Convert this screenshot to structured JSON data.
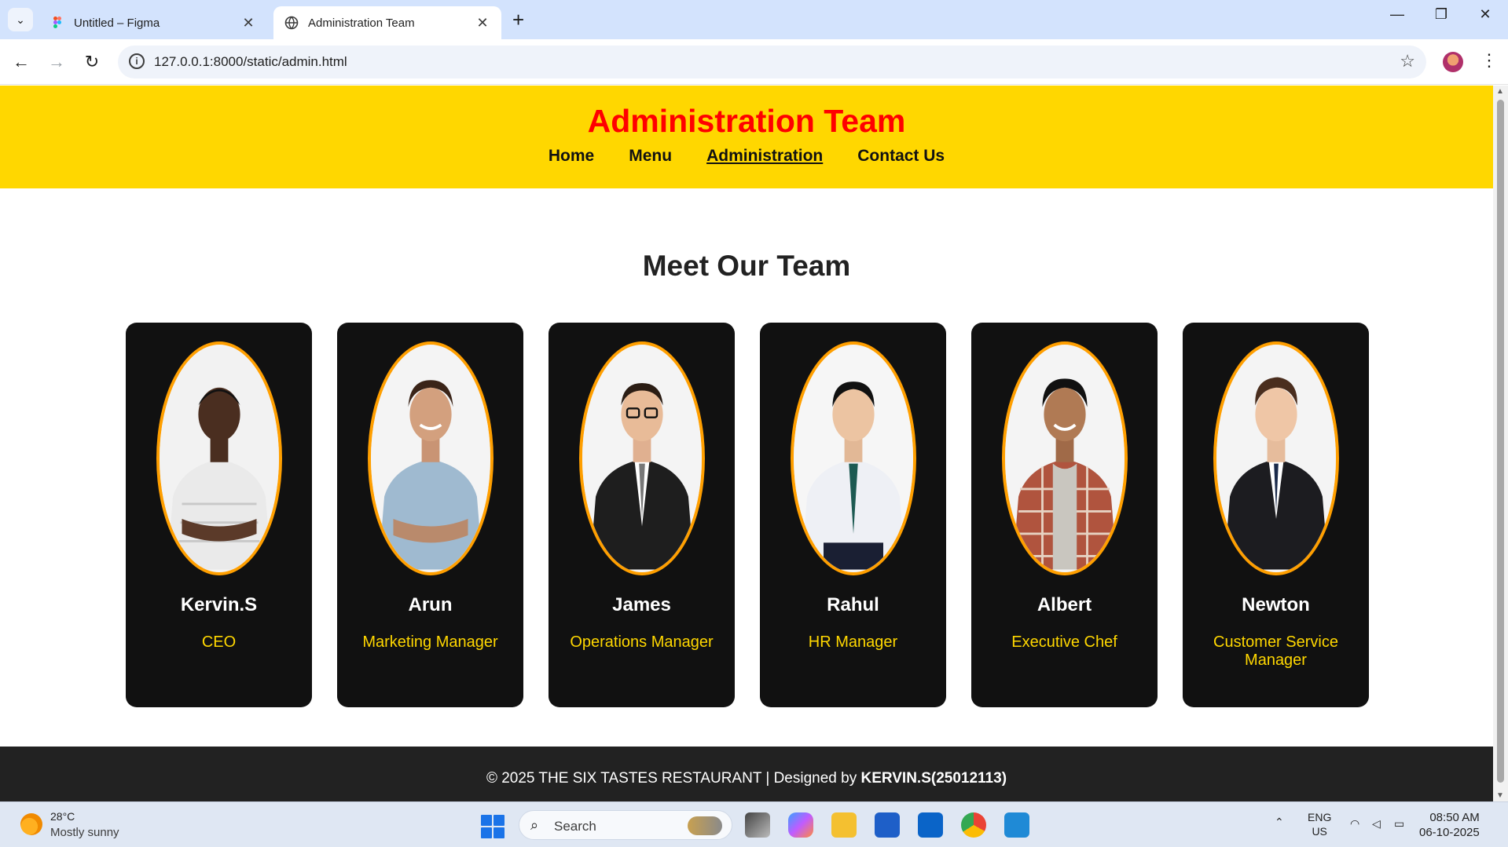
{
  "browser": {
    "tabs": [
      {
        "title": "Untitled – Figma",
        "active": false,
        "icon": "figma-icon"
      },
      {
        "title": "Administration Team",
        "active": true,
        "icon": "globe-icon"
      }
    ],
    "url": "127.0.0.1:8000/static/admin.html"
  },
  "site": {
    "title": "Administration Team",
    "nav": [
      {
        "label": "Home",
        "current": false
      },
      {
        "label": "Menu",
        "current": false
      },
      {
        "label": "Administration",
        "current": true
      },
      {
        "label": "Contact Us",
        "current": false
      }
    ],
    "section_title": "Meet Our Team",
    "team": [
      {
        "name": "Kervin.S",
        "role": "CEO",
        "outfit": "white-striped-shirt"
      },
      {
        "name": "Arun",
        "role": "Marketing Manager",
        "outfit": "blue-shirt"
      },
      {
        "name": "James",
        "role": "Operations Manager",
        "outfit": "black-suit"
      },
      {
        "name": "Rahul",
        "role": "HR Manager",
        "outfit": "white-shirt-tie"
      },
      {
        "name": "Albert",
        "role": "Executive Chef",
        "outfit": "plaid-shirt"
      },
      {
        "name": "Newton",
        "role": "Customer Service Manager",
        "outfit": "black-suit"
      }
    ],
    "footer": {
      "text": "© 2025 THE SIX TASTES RESTAURANT | Designed by ",
      "designer": "KERVIN.S(25012113)"
    },
    "colors": {
      "header_bg": "#ffd700",
      "title": "#ff0000",
      "card_bg": "#111111",
      "photo_border": "#ff9f00",
      "role_text": "#ffd700",
      "footer_bg": "#222222"
    }
  },
  "taskbar": {
    "weather": {
      "temp": "28°C",
      "desc": "Mostly sunny"
    },
    "search_label": "Search",
    "lang": {
      "line1": "ENG",
      "line2": "US"
    },
    "time": "08:50 AM",
    "date": "06-10-2025"
  }
}
